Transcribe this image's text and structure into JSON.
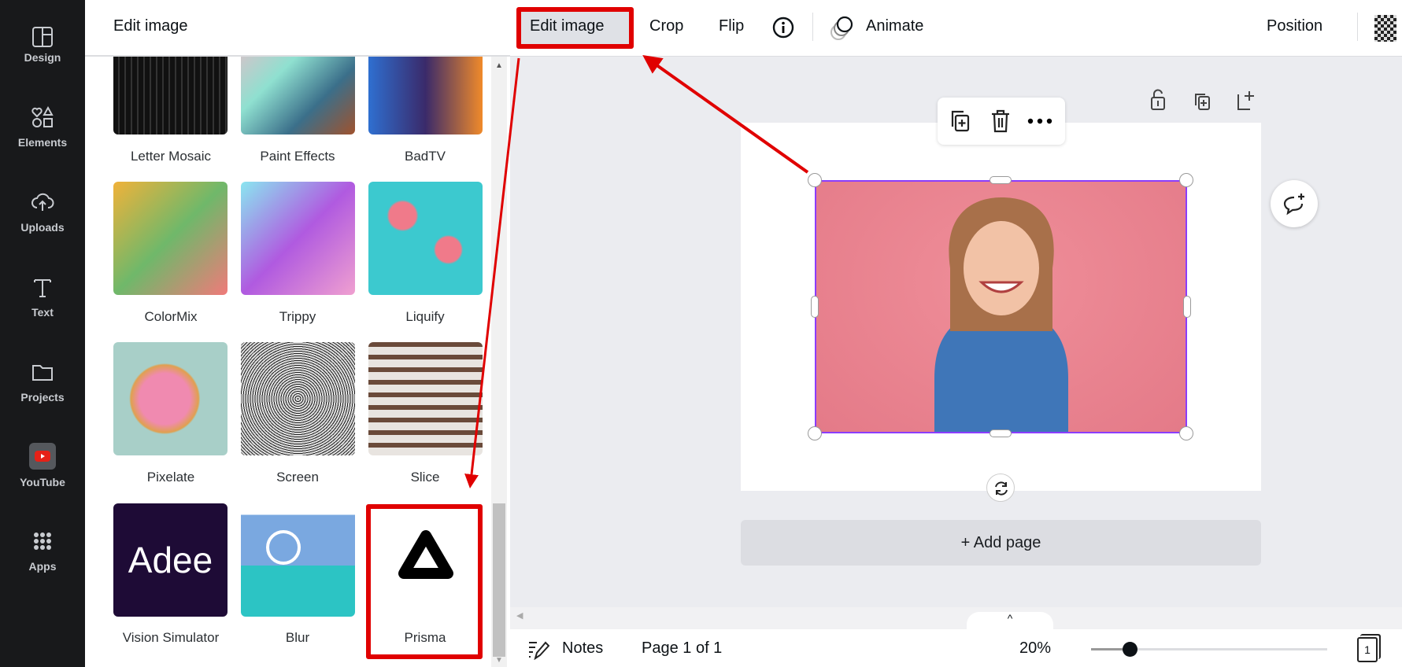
{
  "sidebar": {
    "items": [
      {
        "label": "Design",
        "icon": "layout-icon"
      },
      {
        "label": "Elements",
        "icon": "shapes-icon"
      },
      {
        "label": "Uploads",
        "icon": "cloud-upload-icon"
      },
      {
        "label": "Text",
        "icon": "text-icon"
      },
      {
        "label": "Projects",
        "icon": "folder-icon"
      },
      {
        "label": "YouTube",
        "icon": "youtube-icon"
      },
      {
        "label": "Apps",
        "icon": "apps-grid-icon"
      }
    ]
  },
  "panel": {
    "title": "Edit image",
    "effects": [
      {
        "label": "Letter Mosaic"
      },
      {
        "label": "Paint Effects"
      },
      {
        "label": "BadTV"
      },
      {
        "label": "ColorMix"
      },
      {
        "label": "Trippy"
      },
      {
        "label": "Liquify"
      },
      {
        "label": "Pixelate"
      },
      {
        "label": "Screen"
      },
      {
        "label": "Slice"
      },
      {
        "label": "Vision Simulator",
        "logo_text": "Adee"
      },
      {
        "label": "Blur"
      },
      {
        "label": "Prisma"
      }
    ]
  },
  "toolbar": {
    "edit_image": "Edit image",
    "crop": "Crop",
    "flip": "Flip",
    "animate": "Animate",
    "position": "Position"
  },
  "canvas": {
    "add_page": "+ Add page"
  },
  "bottom": {
    "notes": "Notes",
    "page_indicator": "Page 1 of 1",
    "zoom": "20%",
    "zoom_value": 20,
    "page_count": "1"
  },
  "colors": {
    "highlight": "#e00000",
    "selection": "#8b3dff",
    "sidebar": "#18191b"
  }
}
